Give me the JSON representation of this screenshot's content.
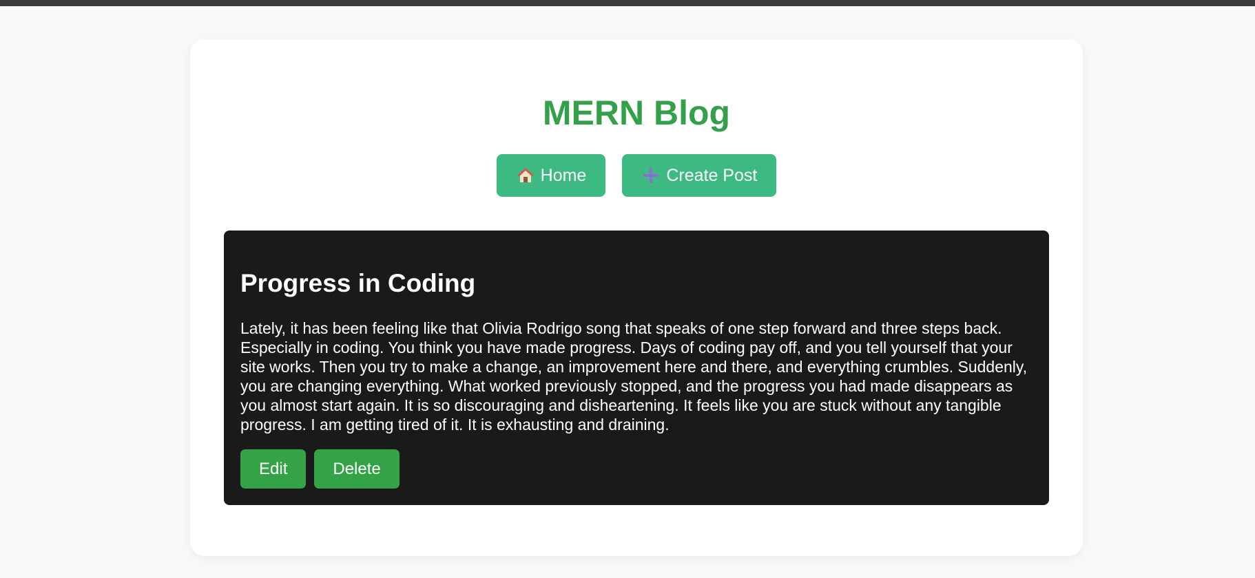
{
  "header": {
    "title": "MERN Blog"
  },
  "nav": {
    "home_label": "Home",
    "home_icon": "house-icon",
    "create_label": "Create Post",
    "create_icon": "plus-icon"
  },
  "post": {
    "title": "Progress in Coding",
    "body": "Lately, it has been feeling like that Olivia Rodrigo song that speaks of one step forward and three steps back. Especially in coding. You think you have made progress. Days of coding pay off, and you tell yourself that your site works. Then you try to make a change, an improvement here and there, and everything crumbles. Suddenly, you are changing everything. What worked previously stopped, and the progress you had made disappears as you almost start again. It is so discouraging and disheartening. It feels like you are stuck without any tangible progress. I am getting tired of it. It is exhausting and draining.",
    "edit_label": "Edit",
    "delete_label": "Delete"
  },
  "colors": {
    "title_green": "#34a04a",
    "nav_button": "#3cba82",
    "action_button": "#34a347",
    "post_bg": "#1a1a1a"
  }
}
